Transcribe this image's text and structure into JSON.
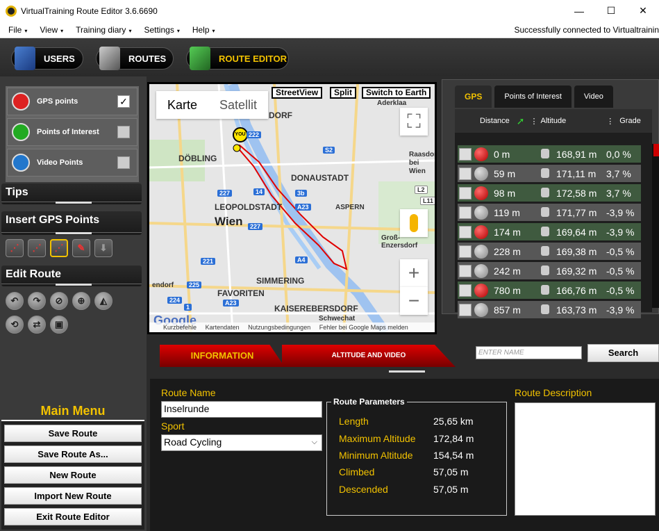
{
  "window": {
    "title": "VirtualTraining Route Editor 3.6.6690",
    "minimize": "—",
    "maximize": "☐",
    "close": "✕"
  },
  "menubar": {
    "items": [
      "File",
      "View",
      "Training diary",
      "Settings",
      "Help"
    ],
    "caret": "▾",
    "status": "Successfully connected to Virtualtrainin"
  },
  "nav": {
    "users": "USERS",
    "routes": "ROUTES",
    "route_editor": "ROUTE EDITOR"
  },
  "layers": {
    "gps": "GPS points",
    "poi": "Points of Interest",
    "video": "Video Points",
    "gps_checked": "✓"
  },
  "sections": {
    "tips": "Tips",
    "insert": "Insert GPS Points",
    "edit": "Edit Route"
  },
  "main_menu": {
    "title": "Main Menu",
    "buttons": [
      "Save Route",
      "Save Route As...",
      "New Route",
      "Import New Route",
      "Exit Route Editor"
    ]
  },
  "map": {
    "tab_map": "Karte",
    "tab_sat": "Satellit",
    "streetview": "StreetView",
    "split": "Split",
    "switch": "Switch to Earth",
    "fullscreen": "⛶",
    "zoom_in": "+",
    "zoom_out": "−",
    "you": "YOU",
    "google": "Google",
    "labels": [
      "DORF",
      "DONAUSTADT",
      "DÖBLING",
      "LEOPOLDSTADT",
      "Wien",
      "ASPERN",
      "Raasdorf bei Wien",
      "Groß-Enzersdorf",
      "SIMMERING",
      "FAVORITEN",
      "KAISEREBERSDORF",
      "Schwechat",
      "Aderklaa",
      "endorf"
    ],
    "roads": [
      "222",
      "S2",
      "14",
      "3b",
      "A23",
      "227",
      "227",
      "221",
      "225",
      "224",
      "A23",
      "A4",
      "L2",
      "L11",
      "1"
    ],
    "footer": [
      "Kurzbefehle",
      "Kartendaten",
      "Nutzungsbedingungen",
      "Fehler bei Google Maps melden"
    ]
  },
  "gps_panel": {
    "tabs": [
      "GPS",
      "Points of Interest",
      "Video"
    ],
    "headers": [
      "Distance",
      "Altitude",
      "Grade"
    ],
    "rows": [
      {
        "distance": "0 m",
        "altitude": "168,91 m",
        "grade": "0,0 %",
        "style": "green",
        "pin": "red"
      },
      {
        "distance": "59 m",
        "altitude": "171,11 m",
        "grade": "3,7 %",
        "style": "gray",
        "pin": "gry"
      },
      {
        "distance": "98 m",
        "altitude": "172,58 m",
        "grade": "3,7 %",
        "style": "green",
        "pin": "red"
      },
      {
        "distance": "119 m",
        "altitude": "171,77 m",
        "grade": "-3,9 %",
        "style": "gray",
        "pin": "gry"
      },
      {
        "distance": "174 m",
        "altitude": "169,64 m",
        "grade": "-3,9 %",
        "style": "green",
        "pin": "red"
      },
      {
        "distance": "228 m",
        "altitude": "169,38 m",
        "grade": "-0,5 %",
        "style": "gray",
        "pin": "gry"
      },
      {
        "distance": "242 m",
        "altitude": "169,32 m",
        "grade": "-0,5 %",
        "style": "gray",
        "pin": "gry"
      },
      {
        "distance": "780 m",
        "altitude": "166,76 m",
        "grade": "-0,5 %",
        "style": "green",
        "pin": "red"
      },
      {
        "distance": "857 m",
        "altitude": "163,73 m",
        "grade": "-3,9 %",
        "style": "gray",
        "pin": "gry"
      }
    ]
  },
  "bottom_tabs": {
    "information": "INFORMATION",
    "altitude_video": "ALTITUDE AND VIDEO",
    "name_placeholder": "ENTER NAME",
    "search": "Search"
  },
  "info": {
    "route_name_label": "Route Name",
    "route_name": "Inselrunde",
    "sport_label": "Sport",
    "sport": "Road Cycling",
    "sport_arrow": "⌵",
    "params_title": "Route Parameters",
    "params": [
      {
        "key": "Length",
        "value": "25,65 km"
      },
      {
        "key": "Maximum Altitude",
        "value": "172,84 m"
      },
      {
        "key": "Minimum Altitude",
        "value": "154,54 m"
      },
      {
        "key": "Climbed",
        "value": "57,05 m"
      },
      {
        "key": "Descended",
        "value": "57,05 m"
      }
    ],
    "desc_label": "Route Description"
  },
  "colors": {
    "accent": "#f2c200",
    "red": "#d00000",
    "route": "#e00000"
  }
}
